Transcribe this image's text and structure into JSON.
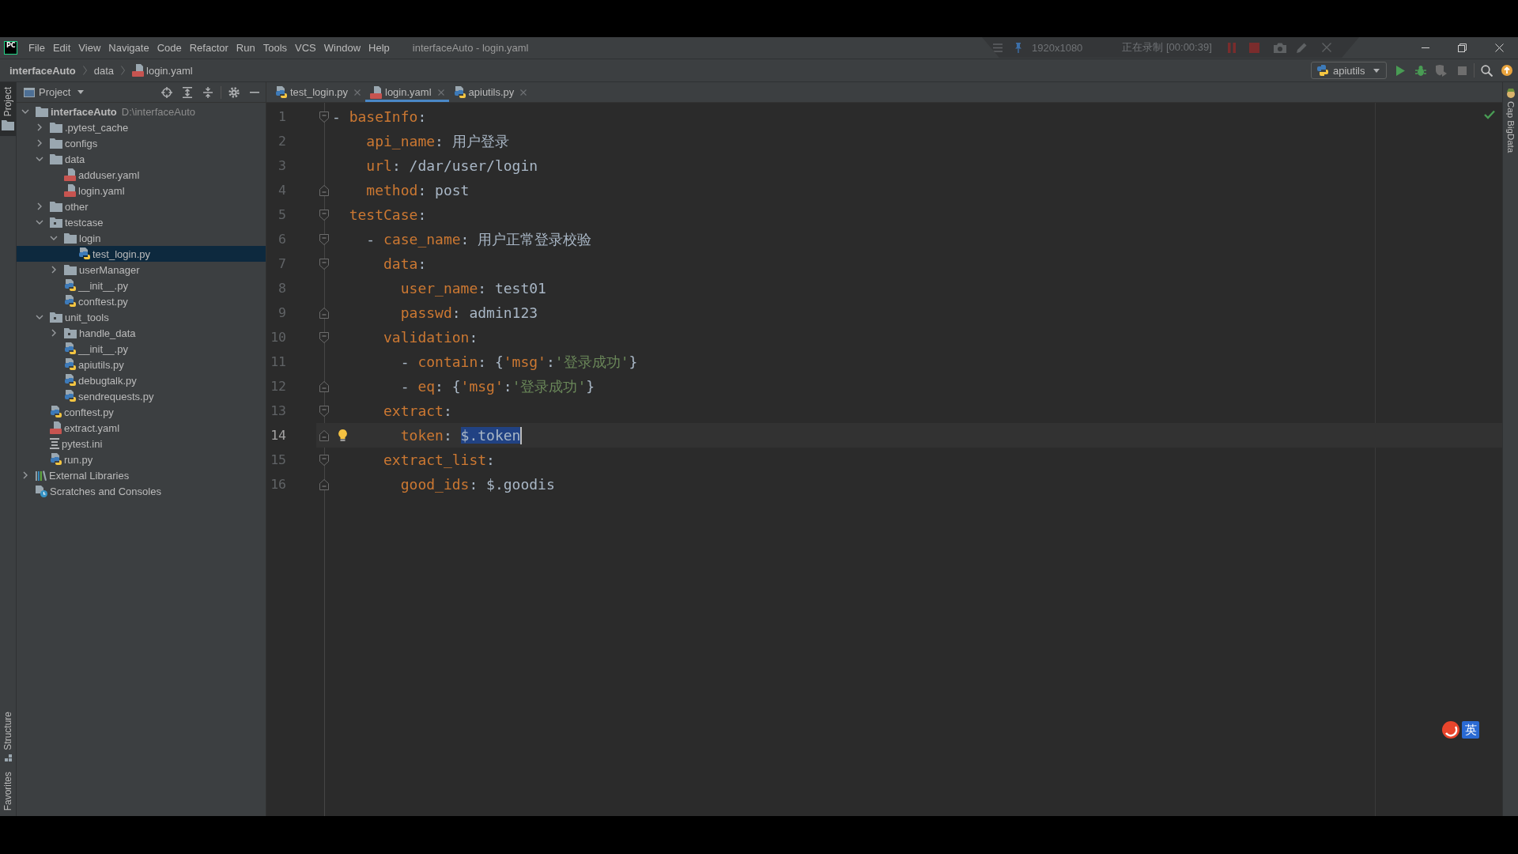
{
  "window": {
    "logo": "PC",
    "menu": [
      "File",
      "Edit",
      "View",
      "Navigate",
      "Code",
      "Refactor",
      "Run",
      "Tools",
      "VCS",
      "Window",
      "Help"
    ],
    "title": "interfaceAuto - login.yaml"
  },
  "recorder": {
    "resolution": "1920x1080",
    "status": "正在录制 [00:00:39]"
  },
  "navbar": {
    "breadcrumbs": [
      {
        "label": "interfaceAuto",
        "kind": "project"
      },
      {
        "label": "data",
        "kind": "folder"
      },
      {
        "label": "login.yaml",
        "kind": "yaml"
      }
    ],
    "run_config": {
      "label": "apiutils",
      "kind": "python"
    }
  },
  "left_strip": {
    "top": [
      {
        "label": "Project",
        "kind": "project",
        "selected": true
      }
    ],
    "bottom": [
      {
        "label": "Structure",
        "kind": "structure",
        "selected": false
      },
      {
        "label": "Favorites",
        "kind": "favorites",
        "selected": false
      }
    ]
  },
  "project_panel": {
    "title": "Project",
    "tree": [
      {
        "label": "interfaceAuto",
        "path": "D:\\interfaceAuto",
        "kind": "project",
        "expanded": true,
        "selected": false,
        "children": [
          {
            "label": ".pytest_cache",
            "kind": "folder",
            "expanded": false,
            "selected": false
          },
          {
            "label": "configs",
            "kind": "folder",
            "expanded": false,
            "selected": false
          },
          {
            "label": "data",
            "kind": "folder",
            "expanded": true,
            "selected": false,
            "children": [
              {
                "label": "adduser.yaml",
                "kind": "yaml",
                "selected": false
              },
              {
                "label": "login.yaml",
                "kind": "yaml",
                "selected": false
              }
            ]
          },
          {
            "label": "other",
            "kind": "folder",
            "expanded": false,
            "selected": false
          },
          {
            "label": "testcase",
            "kind": "package",
            "expanded": true,
            "selected": false,
            "children": [
              {
                "label": "login",
                "kind": "folder",
                "expanded": true,
                "selected": false,
                "children": [
                  {
                    "label": "test_login.py",
                    "kind": "python",
                    "selected": true
                  }
                ]
              },
              {
                "label": "userManager",
                "kind": "folder",
                "expanded": false,
                "selected": false
              },
              {
                "label": "__init__.py",
                "kind": "python",
                "selected": false
              },
              {
                "label": "conftest.py",
                "kind": "python",
                "selected": false
              }
            ]
          },
          {
            "label": "unit_tools",
            "kind": "package",
            "expanded": true,
            "selected": false,
            "children": [
              {
                "label": "handle_data",
                "kind": "package",
                "expanded": false,
                "selected": false
              },
              {
                "label": "__init__.py",
                "kind": "python",
                "selected": false
              },
              {
                "label": "apiutils.py",
                "kind": "python",
                "selected": false
              },
              {
                "label": "debugtalk.py",
                "kind": "python",
                "selected": false
              },
              {
                "label": "sendrequests.py",
                "kind": "python",
                "selected": false
              }
            ]
          },
          {
            "label": "conftest.py",
            "kind": "python",
            "selected": false
          },
          {
            "label": "extract.yaml",
            "kind": "yaml",
            "selected": false
          },
          {
            "label": "pytest.ini",
            "kind": "ini",
            "selected": false
          },
          {
            "label": "run.py",
            "kind": "python",
            "selected": false
          }
        ]
      },
      {
        "label": "External Libraries",
        "kind": "library",
        "expanded": false,
        "selected": false
      },
      {
        "label": "Scratches and Consoles",
        "kind": "scratches",
        "selected": false
      }
    ]
  },
  "tabs": [
    {
      "label": "test_login.py",
      "kind": "python",
      "selected": false
    },
    {
      "label": "login.yaml",
      "kind": "yaml",
      "selected": true
    },
    {
      "label": "apiutils.py",
      "kind": "python",
      "selected": false
    }
  ],
  "editor": {
    "lines": [
      {
        "number": "1",
        "fold_start": true,
        "fold_end": false,
        "current": false,
        "intention": false,
        "tokens": [
          {
            "text": "- ",
            "kind": "plain"
          },
          {
            "text": "baseInfo",
            "kind": "key"
          },
          {
            "text": ":",
            "kind": "plain"
          }
        ]
      },
      {
        "number": "2",
        "fold_start": false,
        "fold_end": false,
        "current": false,
        "intention": false,
        "tokens": [
          {
            "text": "    api_name",
            "kind": "key"
          },
          {
            "text": ": 用户登录",
            "kind": "plain"
          }
        ]
      },
      {
        "number": "3",
        "fold_start": false,
        "fold_end": false,
        "current": false,
        "intention": false,
        "tokens": [
          {
            "text": "    url",
            "kind": "key"
          },
          {
            "text": ": /dar/user/login",
            "kind": "plain"
          }
        ]
      },
      {
        "number": "4",
        "fold_start": false,
        "fold_end": true,
        "current": false,
        "intention": false,
        "tokens": [
          {
            "text": "    method",
            "kind": "key"
          },
          {
            "text": ": post",
            "kind": "plain"
          }
        ]
      },
      {
        "number": "5",
        "fold_start": true,
        "fold_end": false,
        "current": false,
        "intention": false,
        "tokens": [
          {
            "text": "  testCase",
            "kind": "key"
          },
          {
            "text": ":",
            "kind": "plain"
          }
        ]
      },
      {
        "number": "6",
        "fold_start": true,
        "fold_end": false,
        "current": false,
        "intention": false,
        "tokens": [
          {
            "text": "    - ",
            "kind": "plain"
          },
          {
            "text": "case_name",
            "kind": "key"
          },
          {
            "text": ": 用户正常登录校验",
            "kind": "plain"
          }
        ]
      },
      {
        "number": "7",
        "fold_start": true,
        "fold_end": false,
        "current": false,
        "intention": false,
        "tokens": [
          {
            "text": "      data",
            "kind": "key"
          },
          {
            "text": ":",
            "kind": "plain"
          }
        ]
      },
      {
        "number": "8",
        "fold_start": false,
        "fold_end": false,
        "current": false,
        "intention": false,
        "tokens": [
          {
            "text": "        user_name",
            "kind": "key"
          },
          {
            "text": ": test01",
            "kind": "plain"
          }
        ]
      },
      {
        "number": "9",
        "fold_start": false,
        "fold_end": true,
        "current": false,
        "intention": false,
        "tokens": [
          {
            "text": "        passwd",
            "kind": "key"
          },
          {
            "text": ": admin123",
            "kind": "plain"
          }
        ]
      },
      {
        "number": "10",
        "fold_start": true,
        "fold_end": false,
        "current": false,
        "intention": false,
        "tokens": [
          {
            "text": "      validation",
            "kind": "key"
          },
          {
            "text": ":",
            "kind": "plain"
          }
        ]
      },
      {
        "number": "11",
        "fold_start": false,
        "fold_end": false,
        "current": false,
        "intention": false,
        "tokens": [
          {
            "text": "        - ",
            "kind": "plain"
          },
          {
            "text": "contain",
            "kind": "key"
          },
          {
            "text": ": {",
            "kind": "plain"
          },
          {
            "text": "'msg'",
            "kind": "key"
          },
          {
            "text": ":",
            "kind": "plain"
          },
          {
            "text": "'登录成功'",
            "kind": "string"
          },
          {
            "text": "}",
            "kind": "plain"
          }
        ]
      },
      {
        "number": "12",
        "fold_start": false,
        "fold_end": true,
        "current": false,
        "intention": false,
        "tokens": [
          {
            "text": "        - ",
            "kind": "plain"
          },
          {
            "text": "eq",
            "kind": "key"
          },
          {
            "text": ": {",
            "kind": "plain"
          },
          {
            "text": "'msg'",
            "kind": "key"
          },
          {
            "text": ":",
            "kind": "plain"
          },
          {
            "text": "'登录成功'",
            "kind": "string"
          },
          {
            "text": "}",
            "kind": "plain"
          }
        ]
      },
      {
        "number": "13",
        "fold_start": true,
        "fold_end": false,
        "current": false,
        "intention": false,
        "tokens": [
          {
            "text": "      extract",
            "kind": "key"
          },
          {
            "text": ":",
            "kind": "plain"
          }
        ]
      },
      {
        "number": "14",
        "fold_start": false,
        "fold_end": true,
        "current": true,
        "intention": true,
        "tokens": [
          {
            "text": "        token",
            "kind": "key"
          },
          {
            "text": ": ",
            "kind": "plain"
          }
        ],
        "selected_text": "$.token"
      },
      {
        "number": "15",
        "fold_start": true,
        "fold_end": false,
        "current": false,
        "intention": false,
        "tokens": [
          {
            "text": "      extract_list",
            "kind": "key"
          },
          {
            "text": ":",
            "kind": "plain"
          }
        ]
      },
      {
        "number": "16",
        "fold_start": false,
        "fold_end": true,
        "current": false,
        "intention": false,
        "tokens": [
          {
            "text": "        good_ids",
            "kind": "key"
          },
          {
            "text": ": $.goodis",
            "kind": "plain"
          }
        ]
      }
    ]
  },
  "right_strip": [
    {
      "label": "Cap BigData"
    }
  ],
  "ime": {
    "mode": "英"
  }
}
